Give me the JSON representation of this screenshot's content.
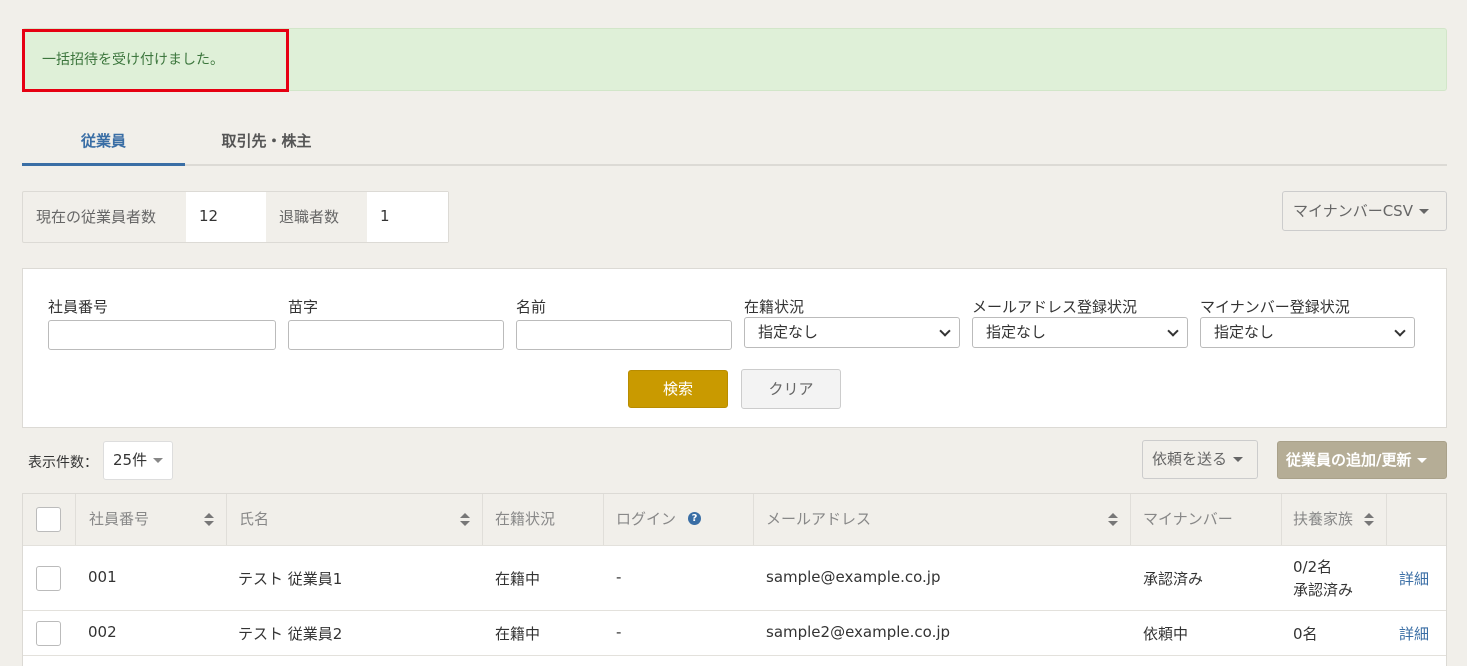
{
  "alert": {
    "message": "一括招待を受け付けました。"
  },
  "tabs": [
    {
      "label": "従業員",
      "active": true
    },
    {
      "label": "取引先・株主",
      "active": false
    }
  ],
  "counts": {
    "current_label": "現在の従業員者数",
    "current_value": "12",
    "retired_label": "退職者数",
    "retired_value": "1"
  },
  "csv_button": {
    "label": "マイナンバーCSV"
  },
  "filters": {
    "employee_no": {
      "label": "社員番号",
      "value": ""
    },
    "last_name": {
      "label": "苗字",
      "value": ""
    },
    "first_name": {
      "label": "名前",
      "value": ""
    },
    "status": {
      "label": "在籍状況",
      "selected": "指定なし"
    },
    "email_status": {
      "label": "メールアドレス登録状況",
      "selected": "指定なし"
    },
    "mynumber_status": {
      "label": "マイナンバー登録状況",
      "selected": "指定なし"
    },
    "search_label": "検索",
    "clear_label": "クリア"
  },
  "toolbar": {
    "per_page_label": "表示件数：",
    "per_page_value": "25件",
    "request_label": "依頼を送る",
    "add_label": "従業員の追加/更新"
  },
  "table": {
    "headers": {
      "employee_no": "社員番号",
      "name": "氏名",
      "status": "在籍状況",
      "login": "ログイン",
      "email": "メールアドレス",
      "mynumber": "マイナンバー",
      "dependents": "扶養家族"
    },
    "rows": [
      {
        "employee_no": "001",
        "name": "テスト 従業員1",
        "status": "在籍中",
        "login": "-",
        "email": "sample@example.co.jp",
        "mynumber": "承認済み",
        "dependents_count": "0/2名",
        "dependents_status": "承認済み",
        "detail": "詳細"
      },
      {
        "employee_no": "002",
        "name": "テスト 従業員2",
        "status": "在籍中",
        "login": "-",
        "email": "sample2@example.co.jp",
        "mynumber": "依頼中",
        "dependents_count": "0名",
        "dependents_status": "",
        "detail": "詳細"
      }
    ]
  },
  "colors": {
    "background": "#f1efea",
    "alert_bg": "#dff0d8",
    "alert_text": "#3c763d",
    "highlight": "#e60012",
    "accent": "#3a6ea5",
    "search_button": "#c99a00",
    "add_button": "#b5ad96"
  }
}
